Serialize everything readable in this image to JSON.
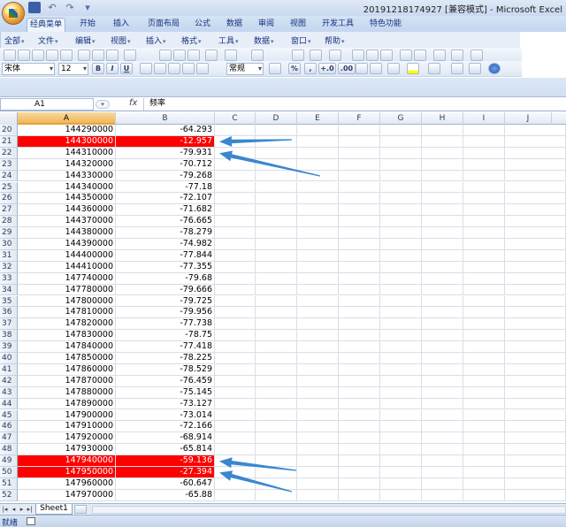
{
  "window": {
    "title": "20191218174927 [兼容模式] - Microsoft Excel"
  },
  "quick_access": {
    "undo": "↶",
    "redo": "↷",
    "customize": "▾"
  },
  "ribbon_tabs": [
    "经典菜单",
    "开始",
    "插入",
    "页面布局",
    "公式",
    "数据",
    "审阅",
    "视图",
    "开发工具",
    "特色功能"
  ],
  "active_tab": "经典菜单",
  "menus": [
    "全部",
    "文件",
    "编辑",
    "视图",
    "插入",
    "格式",
    "工具",
    "数据",
    "窗口",
    "帮助"
  ],
  "toolbar2": {
    "font_name": "宋体",
    "font_size": "12",
    "bold": "B",
    "italic": "I",
    "underline": "U",
    "number_format": "常规",
    "percent": "%",
    "comma": ",",
    "inc_decimal": "+.0",
    "dec_decimal": ".00"
  },
  "formula_bar": {
    "name_box": "A1",
    "fx_label": "fx",
    "content": "频率"
  },
  "columns": [
    "A",
    "B",
    "C",
    "D",
    "E",
    "F",
    "G",
    "H",
    "I",
    "J"
  ],
  "selected_column": "A",
  "rows": [
    {
      "n": "20",
      "a": "144290000",
      "b": "-64.293",
      "hl": false
    },
    {
      "n": "21",
      "a": "144300000",
      "b": "-12.957",
      "hl": true
    },
    {
      "n": "22",
      "a": "144310000",
      "b": "-79.931",
      "hl": false
    },
    {
      "n": "23",
      "a": "144320000",
      "b": "-70.712",
      "hl": false
    },
    {
      "n": "24",
      "a": "144330000",
      "b": "-79.268",
      "hl": false
    },
    {
      "n": "25",
      "a": "144340000",
      "b": "-77.18",
      "hl": false
    },
    {
      "n": "26",
      "a": "144350000",
      "b": "-72.107",
      "hl": false
    },
    {
      "n": "27",
      "a": "144360000",
      "b": "-71.682",
      "hl": false
    },
    {
      "n": "28",
      "a": "144370000",
      "b": "-76.665",
      "hl": false
    },
    {
      "n": "29",
      "a": "144380000",
      "b": "-78.279",
      "hl": false
    },
    {
      "n": "30",
      "a": "144390000",
      "b": "-74.982",
      "hl": false
    },
    {
      "n": "31",
      "a": "144400000",
      "b": "-77.844",
      "hl": false
    },
    {
      "n": "32",
      "a": "144410000",
      "b": "-77.355",
      "hl": false
    },
    {
      "n": "33",
      "a": "147740000",
      "b": "-79.68",
      "hl": false
    },
    {
      "n": "34",
      "a": "147780000",
      "b": "-79.666",
      "hl": false
    },
    {
      "n": "35",
      "a": "147800000",
      "b": "-79.725",
      "hl": false
    },
    {
      "n": "36",
      "a": "147810000",
      "b": "-79.956",
      "hl": false
    },
    {
      "n": "37",
      "a": "147820000",
      "b": "-77.738",
      "hl": false
    },
    {
      "n": "38",
      "a": "147830000",
      "b": "-78.75",
      "hl": false
    },
    {
      "n": "39",
      "a": "147840000",
      "b": "-77.418",
      "hl": false
    },
    {
      "n": "40",
      "a": "147850000",
      "b": "-78.225",
      "hl": false
    },
    {
      "n": "41",
      "a": "147860000",
      "b": "-78.529",
      "hl": false
    },
    {
      "n": "42",
      "a": "147870000",
      "b": "-76.459",
      "hl": false
    },
    {
      "n": "43",
      "a": "147880000",
      "b": "-75.145",
      "hl": false
    },
    {
      "n": "44",
      "a": "147890000",
      "b": "-73.127",
      "hl": false
    },
    {
      "n": "45",
      "a": "147900000",
      "b": "-73.014",
      "hl": false
    },
    {
      "n": "46",
      "a": "147910000",
      "b": "-72.166",
      "hl": false
    },
    {
      "n": "47",
      "a": "147920000",
      "b": "-68.914",
      "hl": false
    },
    {
      "n": "48",
      "a": "147930000",
      "b": "-65.814",
      "hl": false
    },
    {
      "n": "49",
      "a": "147940000",
      "b": "-59.136",
      "hl": true
    },
    {
      "n": "50",
      "a": "147950000",
      "b": "-27.394",
      "hl": true
    },
    {
      "n": "51",
      "a": "147960000",
      "b": "-60.647",
      "hl": false
    },
    {
      "n": "52",
      "a": "147970000",
      "b": "-65.88",
      "hl": false
    }
  ],
  "highlight_color": "#ff0000",
  "arrow_color": "#3a86d0",
  "sheet_tabs": [
    "Sheet1"
  ],
  "sheet_nav": [
    "|◂",
    "◂",
    "▸",
    "▸|"
  ],
  "status": {
    "text": "就绪"
  }
}
